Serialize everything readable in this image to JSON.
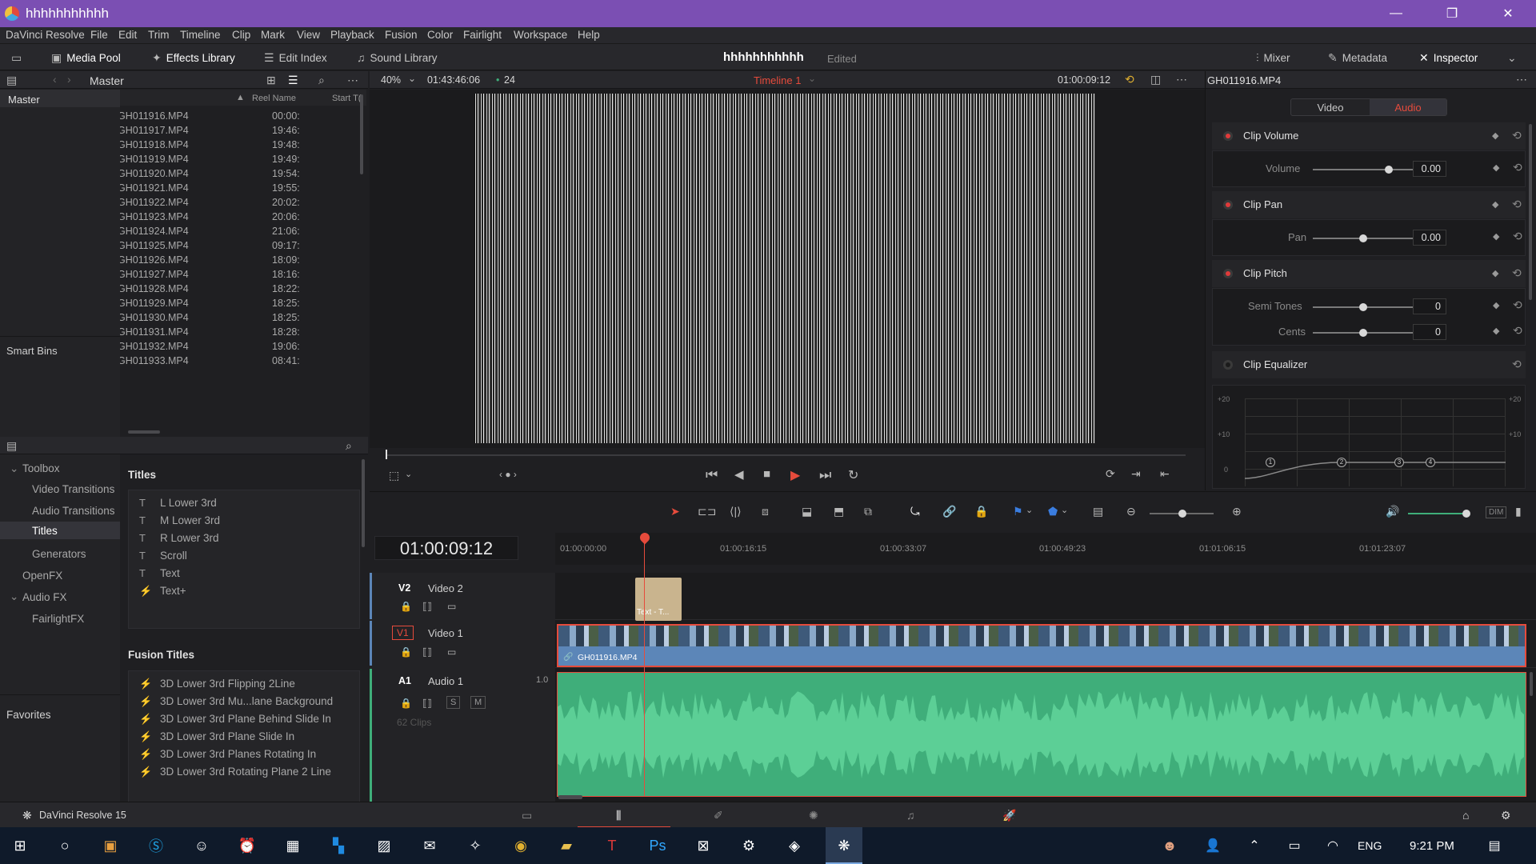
{
  "window": {
    "title": "hhhhhhhhhhh",
    "minimize": "—",
    "maximize": "❐",
    "close": "✕"
  },
  "menu": [
    "DaVinci Resolve",
    "File",
    "Edit",
    "Trim",
    "Timeline",
    "Clip",
    "Mark",
    "View",
    "Playback",
    "Fusion",
    "Color",
    "Fairlight",
    "Workspace",
    "Help"
  ],
  "toolbar": {
    "media_pool": "Media Pool",
    "effects_library": "Effects Library",
    "edit_index": "Edit Index",
    "sound_library": "Sound Library",
    "project_name": "hhhhhhhhhhh",
    "project_status": "Edited",
    "mixer": "Mixer",
    "metadata": "Metadata",
    "inspector": "Inspector"
  },
  "media_pool": {
    "bin_title": "Master",
    "tree_master": "Master",
    "smart_bins": "Smart Bins",
    "col_reel": "Reel Name",
    "col_start": "Start T(",
    "clips": [
      {
        "name": "GH011916.MP4",
        "start": "00:00:"
      },
      {
        "name": "GH011917.MP4",
        "start": "19:46:"
      },
      {
        "name": "GH011918.MP4",
        "start": "19:48:"
      },
      {
        "name": "GH011919.MP4",
        "start": "19:49:"
      },
      {
        "name": "GH011920.MP4",
        "start": "19:54:"
      },
      {
        "name": "GH011921.MP4",
        "start": "19:55:"
      },
      {
        "name": "GH011922.MP4",
        "start": "20:02:"
      },
      {
        "name": "GH011923.MP4",
        "start": "20:06:"
      },
      {
        "name": "GH011924.MP4",
        "start": "21:06:"
      },
      {
        "name": "GH011925.MP4",
        "start": "09:17:"
      },
      {
        "name": "GH011926.MP4",
        "start": "18:09:"
      },
      {
        "name": "GH011927.MP4",
        "start": "18:16:"
      },
      {
        "name": "GH011928.MP4",
        "start": "18:22:"
      },
      {
        "name": "GH011929.MP4",
        "start": "18:25:"
      },
      {
        "name": "GH011930.MP4",
        "start": "18:25:"
      },
      {
        "name": "GH011931.MP4",
        "start": "18:28:"
      },
      {
        "name": "GH011932.MP4",
        "start": "19:06:"
      },
      {
        "name": "GH011933.MP4",
        "start": "08:41:"
      }
    ]
  },
  "effects": {
    "toolbox": "Toolbox",
    "video_transitions": "Video Transitions",
    "audio_transitions": "Audio Transitions",
    "titles": "Titles",
    "generators": "Generators",
    "openfx": "OpenFX",
    "audio_fx": "Audio FX",
    "fairlight_fx": "FairlightFX",
    "favorites": "Favorites",
    "titles_header": "Titles",
    "titles_items": [
      "L Lower 3rd",
      "M Lower 3rd",
      "R Lower 3rd",
      "Scroll",
      "Text",
      "Text+"
    ],
    "fusion_header": "Fusion Titles",
    "fusion_items": [
      "3D Lower 3rd Flipping 2Line",
      "3D Lower 3rd Mu...lane Background",
      "3D Lower 3rd Plane Behind Slide In",
      "3D Lower 3rd Plane Slide In",
      "3D Lower 3rd Planes Rotating In",
      "3D Lower 3rd Rotating Plane 2 Line"
    ]
  },
  "viewer": {
    "zoom": "40%",
    "source_tc": "01:43:46:06",
    "fps": "24",
    "timeline_name": "Timeline 1",
    "record_tc": "01:00:09:12"
  },
  "inspector": {
    "clip_name": "GH011916.MP4",
    "tab_video": "Video",
    "tab_audio": "Audio",
    "clip_volume": "Clip Volume",
    "volume_label": "Volume",
    "volume_value": "0.00",
    "clip_pan": "Clip Pan",
    "pan_label": "Pan",
    "pan_value": "0.00",
    "clip_pitch": "Clip Pitch",
    "semitones_label": "Semi Tones",
    "semitones_value": "0",
    "cents_label": "Cents",
    "cents_value": "0",
    "clip_eq": "Clip Equalizer",
    "eq_labels": [
      "+20",
      "+10",
      "0"
    ],
    "eq_bands": [
      "1",
      "2",
      "3",
      "4"
    ]
  },
  "timeline": {
    "timecode": "01:00:09:12",
    "ruler": [
      "01:00:00:00",
      "01:00:16:15",
      "01:00:33:07",
      "01:00:49:23",
      "01:01:06:15",
      "01:01:23:07"
    ],
    "v2_id": "V2",
    "v2_name": "Video 2",
    "v1_id": "V1",
    "v1_name": "Video 1",
    "a1_id": "A1",
    "a1_name": "Audio 1",
    "a1_level": "1.0",
    "a1_clips": "62 Clips",
    "solo": "S",
    "mute": "M",
    "title_clip": "Text - T...",
    "video_clip": "GH011916.MP4"
  },
  "footer": {
    "app": "DaVinci Resolve 15"
  },
  "taskbar": {
    "lang": "ENG",
    "time": "9:21 PM"
  },
  "colors": {
    "accent": "#e64b3c",
    "titlebar": "#7b4fb3",
    "audio": "#3fae7a",
    "video": "#5c86b8"
  }
}
